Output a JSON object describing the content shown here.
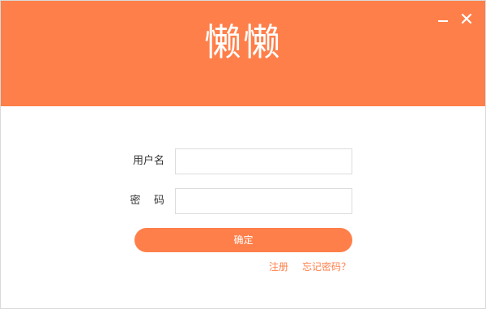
{
  "header": {
    "logo_text": "懒懒",
    "minimize_icon": "minimize-icon",
    "close_icon": "close-icon"
  },
  "form": {
    "username_label": "用户名",
    "username_value": "",
    "password_label": "密    码",
    "password_value": "",
    "confirm_label": "确定"
  },
  "links": {
    "register": "注册",
    "forgot": "忘记密码？"
  },
  "colors": {
    "accent": "#ff7f4a",
    "background": "#ffffff",
    "input_border": "#dcdcdc",
    "label_text": "#333333"
  }
}
